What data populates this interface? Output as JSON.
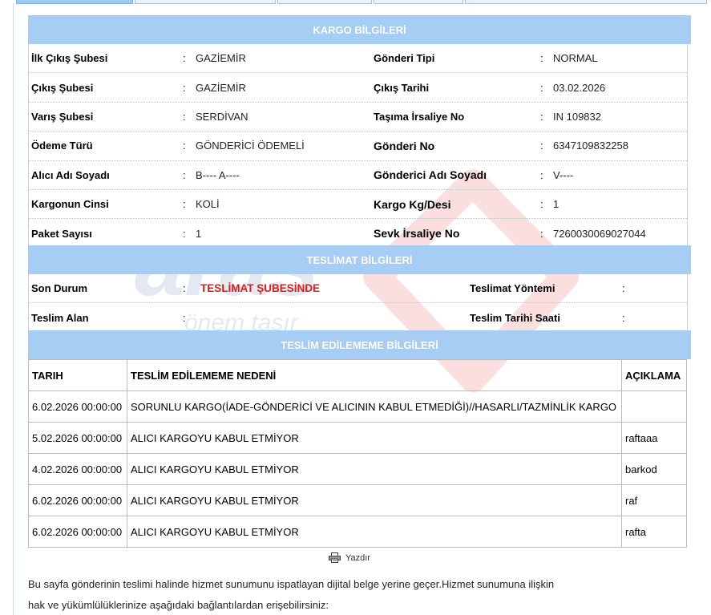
{
  "kargo": {
    "title": "KARGO BİLGİLERİ",
    "rows": [
      {
        "l1": "İlk Çıkış Şubesi",
        "v1": "GAZİEMİR",
        "l2": "Gönderi Tipi",
        "v2": "NORMAL"
      },
      {
        "l1": "Çıkış Şubesi",
        "v1": "GAZİEMİR",
        "l2": "Çıkış Tarihi",
        "v2": "03.02.2026"
      },
      {
        "l1": "Varış Şubesi",
        "v1": "SERDİVAN",
        "l2": "Taşıma İrsaliye No",
        "v2": "IN 109832"
      },
      {
        "l1": "Ödeme Türü",
        "v1": "GÖNDERİCİ ÖDEMELİ",
        "l2": "Gönderi No",
        "v2": "6347109832258"
      },
      {
        "l1": "Alıcı Adı Soyadı",
        "v1": "B---- A----",
        "l2": "Gönderici Adı Soyadı",
        "v2": "V----"
      },
      {
        "l1": "Kargonun Cinsi",
        "v1": "KOLİ",
        "l2": "Kargo Kg/Desi",
        "v2": "1"
      },
      {
        "l1": "Paket Sayısı",
        "v1": "1",
        "l2": "Sevk İrsaliye No",
        "v2": "7260030069027044"
      }
    ]
  },
  "teslimat": {
    "title": "TESLİMAT BİLGİLERİ",
    "son_durum_label": "Son Durum",
    "son_durum_value": "TESLİMAT ŞUBESİNDE",
    "teslimat_yontemi_label": "Teslimat Yöntemi",
    "teslim_alan_label": "Teslim Alan",
    "teslim_tarihi_label": "Teslim Tarihi Saati"
  },
  "undelivered": {
    "title": "TESLİM EDİLEMEME BİLGİLERİ",
    "headers": [
      "TARIH",
      "TESLİM EDİLEMEME NEDENİ",
      "AÇIKLAMA"
    ],
    "rows": [
      [
        "6.02.2026 00:00:00",
        "SORUNLU KARGO(İADE-GÖNDERİCİ VE ALICININ KABUL ETMEDİĞİ)//HASARLI/TAZMİNLİK KARGO",
        ""
      ],
      [
        "5.02.2026 00:00:00",
        "ALICI KARGOYU KABUL ETMİYOR",
        "raftaaa"
      ],
      [
        "4.02.2026 00:00:00",
        "ALICI KARGOYU KABUL ETMİYOR",
        "barkod"
      ],
      [
        "6.02.2026 00:00:00",
        "ALICI KARGOYU KABUL ETMİYOR",
        "raf"
      ],
      [
        "6.02.2026 00:00:00",
        "ALICI KARGOYU KABUL ETMİYOR",
        "rafta"
      ]
    ]
  },
  "colon": ":",
  "print_label": "Yazdır",
  "note_line1": "Bu sayfa gönderinin teslimi halinde hizmet sunumunu ispatlayan dijital belge yerine geçer.Hizmet sunumuna ilişkin",
  "note_line2": "hak ve yükümlülüklerinize aşağıdaki bağlantılardan erişebilirsiniz:",
  "watermark": {
    "brand": "aras",
    "slogan": "önem taşır"
  },
  "colors": {
    "header": "#a6cdf4",
    "status": "#e21b1b"
  }
}
